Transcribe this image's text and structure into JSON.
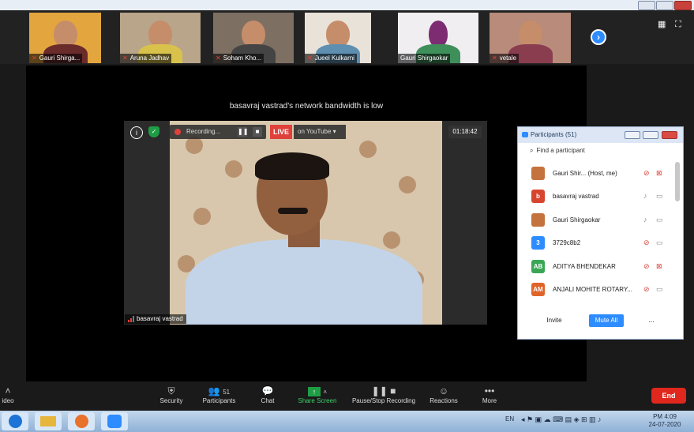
{
  "gallery": {
    "tiles": [
      {
        "name": "Gauri Shirga..."
      },
      {
        "name": "Aruna Jadhav"
      },
      {
        "name": "Soham Kho..."
      },
      {
        "name": "Jueel Kulkarni"
      },
      {
        "name": "Gauri Shirgaokar"
      },
      {
        "name": "vetale"
      }
    ]
  },
  "stage": {
    "bandwidth_notice": "basavraj vastrad's network bandwidth is low",
    "speaker_name": "basavraj vastrad",
    "recording_label": "Recording...",
    "live_label": "LIVE",
    "live_destination": "on YouTube",
    "timer": "01:18:42"
  },
  "participants_panel": {
    "title": "Participants (51)",
    "search_placeholder": "Find a participant",
    "rows": [
      {
        "avatar_text": "",
        "avatar_color": "#c5733e",
        "name": "Gauri Shir...  (Host, me)",
        "mic_muted": true,
        "cam_off": true
      },
      {
        "avatar_text": "b",
        "avatar_color": "#d8452f",
        "name": "basavraj vastrad",
        "mic_muted": false,
        "cam_off": false
      },
      {
        "avatar_text": "",
        "avatar_color": "#c5733e",
        "name": "Gauri Shirgaokar",
        "mic_muted": false,
        "cam_off": false
      },
      {
        "avatar_text": "3",
        "avatar_color": "#2d8cff",
        "name": "3729c8b2",
        "mic_muted": true,
        "cam_off": false
      },
      {
        "avatar_text": "AB",
        "avatar_color": "#3aa655",
        "name": "ADITYA BHENDEKAR",
        "mic_muted": true,
        "cam_off": true
      },
      {
        "avatar_text": "AM",
        "avatar_color": "#e0642a",
        "name": "ANJALI MOHITE ROTARY...",
        "mic_muted": true,
        "cam_off": false
      }
    ],
    "invite_label": "Invite",
    "mute_all_label": "Mute All",
    "more_label": "..."
  },
  "toolbar": {
    "video_label": "ideo",
    "security_label": "Security",
    "participants_label": "Participants",
    "participants_count": "51",
    "chat_label": "Chat",
    "share_label": "Share Screen",
    "record_label": "Pause/Stop Recording",
    "reactions_label": "Reactions",
    "more_label": "More",
    "end_label": "End"
  },
  "taskbar": {
    "lang": "EN",
    "time": "PM 4:09",
    "date": "24-07-2020"
  },
  "colors": {
    "accent": "#2d8cff",
    "danger": "#e0271d",
    "share_green": "#1f9d45"
  }
}
